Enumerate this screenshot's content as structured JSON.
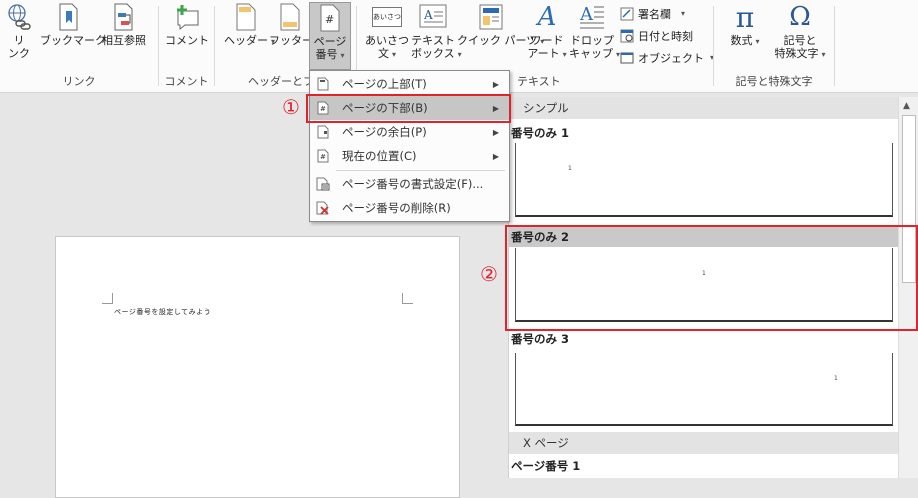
{
  "ribbon": {
    "groups": {
      "link": {
        "label": "リンク",
        "buttons": [
          {
            "label": "リ\nンク",
            "icon": "link-icon"
          },
          {
            "label": "ブックマーク",
            "icon": "bookmark-icon"
          },
          {
            "label": "相互参照",
            "icon": "cross-reference-icon"
          }
        ]
      },
      "comment": {
        "label": "コメント",
        "buttons": [
          {
            "label": "コメント",
            "icon": "comment-icon"
          }
        ]
      },
      "header_footer": {
        "label": "ヘッダーとフッ",
        "buttons": [
          {
            "label": "ヘッダー",
            "icon": "header-icon"
          },
          {
            "label": "フッター",
            "icon": "footer-icon"
          },
          {
            "label1": "ページ",
            "label2": "番号",
            "icon": "page-number-icon"
          }
        ]
      },
      "text": {
        "label": "テキスト",
        "buttons": [
          {
            "label1": "あいさつ",
            "label2": "文",
            "icon": "greeting-icon",
            "icon_text": "あいさつ"
          },
          {
            "label1": "テキスト",
            "label2": "ボックス",
            "icon": "textbox-icon"
          },
          {
            "label": "クイック パーツ",
            "icon": "quick-parts-icon"
          },
          {
            "label1": "ワード",
            "label2": "アート",
            "icon": "wordart-icon"
          },
          {
            "label1": "ドロップ",
            "label2": "キャップ",
            "icon": "dropcap-icon"
          }
        ],
        "small_buttons": [
          {
            "label": "署名欄",
            "icon": "signature-line-icon"
          },
          {
            "label": "日付と時刻",
            "icon": "date-time-icon"
          },
          {
            "label": "オブジェクト",
            "icon": "object-icon"
          }
        ]
      },
      "symbols": {
        "label": "記号と特殊文字",
        "buttons": [
          {
            "label": "数式",
            "icon": "pi-icon",
            "glyph": "π"
          },
          {
            "label1": "記号と",
            "label2": "特殊文字",
            "icon": "omega-icon",
            "glyph": "Ω"
          }
        ]
      }
    }
  },
  "document": {
    "text": "ページ番号を設定してみよう"
  },
  "menu": {
    "items": [
      {
        "label": "ページの上部(T)",
        "has_submenu": true,
        "icon": "page-top-icon"
      },
      {
        "label": "ページの下部(B)",
        "has_submenu": true,
        "icon": "page-bottom-icon",
        "highlighted": true
      },
      {
        "label": "ページの余白(P)",
        "has_submenu": true,
        "icon": "page-margin-icon"
      },
      {
        "label": "現在の位置(C)",
        "has_submenu": true,
        "icon": "current-position-icon"
      },
      {
        "label": "ページ番号の書式設定(F)...",
        "has_submenu": false,
        "icon": "format-page-number-icon"
      },
      {
        "label": "ページ番号の削除(R)",
        "has_submenu": false,
        "icon": "remove-page-number-icon"
      }
    ]
  },
  "gallery": {
    "sections": [
      {
        "header": "シンプル"
      },
      {
        "header": "X ページ"
      }
    ],
    "items": [
      {
        "title": "番号のみ 1",
        "number": "1",
        "align": "left"
      },
      {
        "title": "番号のみ 2",
        "number": "1",
        "align": "center",
        "selected": true
      },
      {
        "title": "番号のみ 3",
        "number": "1",
        "align": "right"
      },
      {
        "title": "ページ番号 1"
      }
    ]
  },
  "annotations": {
    "step1": "①",
    "step2": "②",
    "color": "#e0242e"
  }
}
